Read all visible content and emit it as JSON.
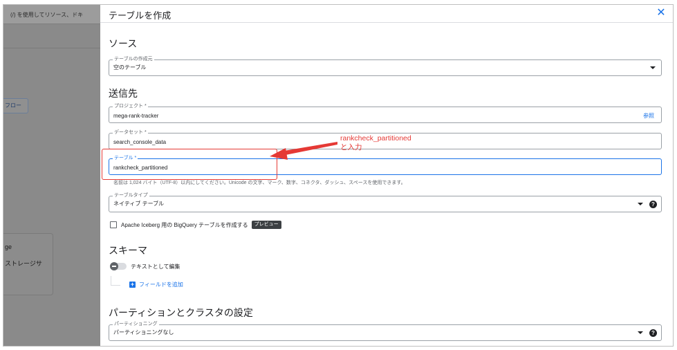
{
  "background_page": {
    "search_text": "　(/) を使用してリソース、ドキ",
    "flow_button": "フロー",
    "card_line1": "ge",
    "card_line2": "ストレージサ"
  },
  "dialog": {
    "title": "テーブルを作成",
    "close_icon": "close-icon"
  },
  "source": {
    "heading": "ソース",
    "create_from_label": "テーブルの作成元",
    "create_from_value": "空のテーブル"
  },
  "destination": {
    "heading": "送信先",
    "project_label": "プロジェクト *",
    "project_value": "mega-rank-tracker",
    "browse_link": "参照",
    "dataset_label": "データセット *",
    "dataset_value": "search_console_data",
    "table_label": "テーブル *",
    "table_value": "rankcheck_partitioned",
    "table_hint": "名前は 1,024 バイト（UTF-8）以内にしてください。Unicode の文字、マーク、数字、コネクタ、ダッシュ、スペースを使用できます。",
    "table_type_label": "テーブルタイプ",
    "table_type_value": "ネイティブ テーブル"
  },
  "iceberg": {
    "label": "Apache Iceberg 用の BigQuery テーブルを作成する",
    "badge": "プレビュー",
    "checked": false
  },
  "schema": {
    "heading": "スキーマ",
    "edit_as_text": "テキストとして編集",
    "add_field": "フィールドを追加"
  },
  "partition": {
    "heading": "パーティションとクラスタの設定",
    "partitioning_label": "パーティショニング",
    "partitioning_value": "パーティショニングなし"
  },
  "annotation": {
    "line1": "rankcheck_partitioned",
    "line2": "と入力",
    "color": "#e53935"
  },
  "colors": {
    "accent": "#1a73e8",
    "overlay": "#8a8a8a"
  }
}
